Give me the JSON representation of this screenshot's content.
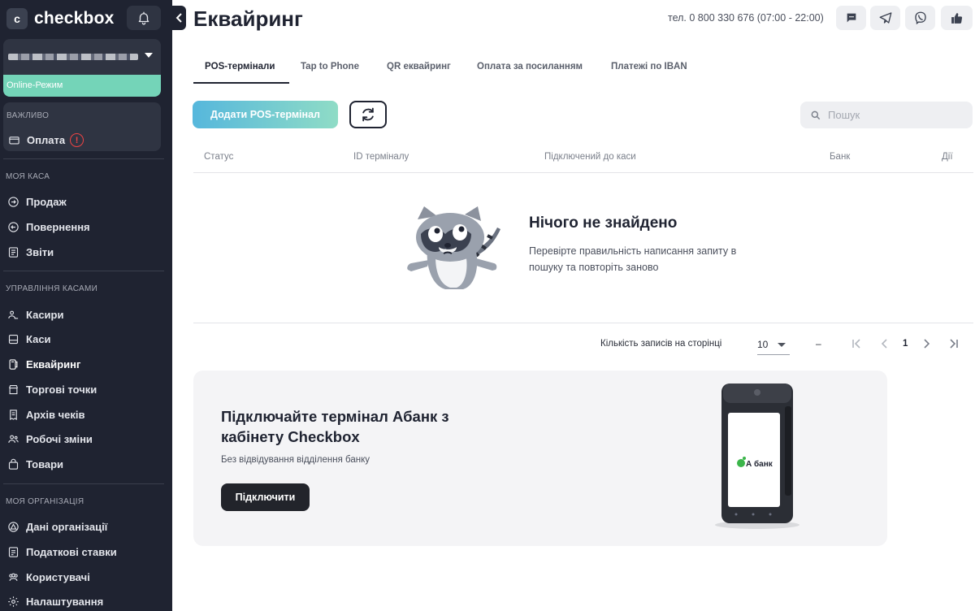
{
  "brand": {
    "name": "checkbox",
    "badge": "c"
  },
  "account": {
    "mode": "Online-Режим"
  },
  "important": {
    "label": "ВАЖЛИВО",
    "item": "Оплата",
    "warn": "!"
  },
  "sidebar": {
    "sections": [
      {
        "label": "МОЯ КАСА",
        "items": [
          "Продаж",
          "Повернення",
          "Звіти"
        ]
      },
      {
        "label": "УПРАВЛІННЯ КАСАМИ",
        "items": [
          "Касири",
          "Каси",
          "Еквайринг",
          "Торгові точки",
          "Архів чеків",
          "Робочі зміни",
          "Товари"
        ]
      },
      {
        "label": "МОЯ ОРГАНІЗАЦІЯ",
        "items": [
          "Дані організації",
          "Податкові ставки",
          "Користувачі",
          "Налаштування"
        ]
      }
    ],
    "active_item": "Еквайринг"
  },
  "header": {
    "title": "Еквайринг",
    "phone": "тел. 0 800 330 676 (07:00 - 22:00)"
  },
  "tabs": [
    "POS-термінали",
    "Tap to Phone",
    "QR еквайринг",
    "Оплата за посиланням",
    "Платежі по IBAN"
  ],
  "toolbar": {
    "add_label": "Додати POS-термінал",
    "search_placeholder": "Пошук"
  },
  "table": {
    "columns": [
      "Статус",
      "ID терміналу",
      "Підключений до каси",
      "Банк",
      "Дії"
    ]
  },
  "empty": {
    "title": "Нічого не знайдено",
    "text": "Перевірте правильність написання запиту в пошуку та повторіть заново"
  },
  "pagination": {
    "label": "Кількість записів на сторінці",
    "page_size": "10",
    "range": "–",
    "page": "1"
  },
  "promo": {
    "title": "Підключайте термінал Абанк з кабінету Checkbox",
    "subtitle": "Без відвідування відділення банку",
    "button": "Підключити",
    "terminal_logo": "А банк"
  }
}
